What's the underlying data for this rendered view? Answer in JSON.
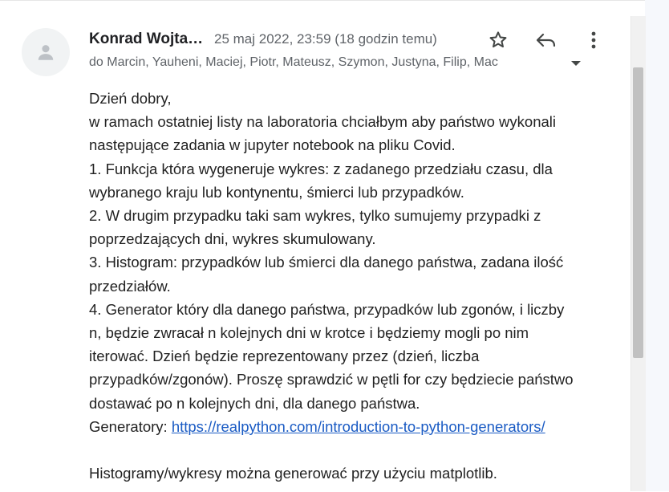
{
  "header": {
    "sender_name": "Konrad Wojta…",
    "date": "25 maj 2022, 23:59 (18 godzin temu)",
    "recipients": "do Marcin, Yauheni, Maciej, Piotr, Mateusz, Szymon, Justyna, Filip, Mac"
  },
  "icons": {
    "avatar": "person-icon",
    "star": "star-icon",
    "reply": "reply-icon",
    "more": "more-vert-icon",
    "caret": "caret-down-icon"
  },
  "body": {
    "lines": [
      "Dzień dobry,",
      "w ramach ostatniej listy na laboratoria chciałbym aby państwo wykonali",
      "następujące zadania w jupyter notebook na pliku Covid.",
      "1. Funkcja która wygeneruje wykres: z zadanego przedziału czasu, dla",
      "wybranego kraju lub kontynentu, śmierci lub przypadków.",
      "2. W drugim przypadku taki sam wykres, tylko sumujemy przypadki z",
      "poprzedzających dni, wykres skumulowany.",
      "3. Histogram: przypadków lub śmierci dla danego państwa, zadana ilość",
      "przedziałów.",
      "4. Generator który dla danego państwa, przypadków lub zgonów, i liczby",
      "n, będzie zwracał n kolejnych dni w krotce i będziemy mogli po nim",
      "iterować. Dzień będzie reprezentowany przez (dzień, liczba",
      "przypadków/zgonów). Proszę sprawdzić w pętli for czy będziecie państwo",
      "dostawać po n kolejnych dni, dla danego państwa."
    ],
    "generators_label": "Generatory: ",
    "generators_link": "https://realpython.com/introduction-to-python-generators/",
    "footer_line": "Histogramy/wykresy można generować przy użyciu matplotlib."
  },
  "colors": {
    "link": "#1a5bc4",
    "secondary_text": "#5f6368"
  }
}
